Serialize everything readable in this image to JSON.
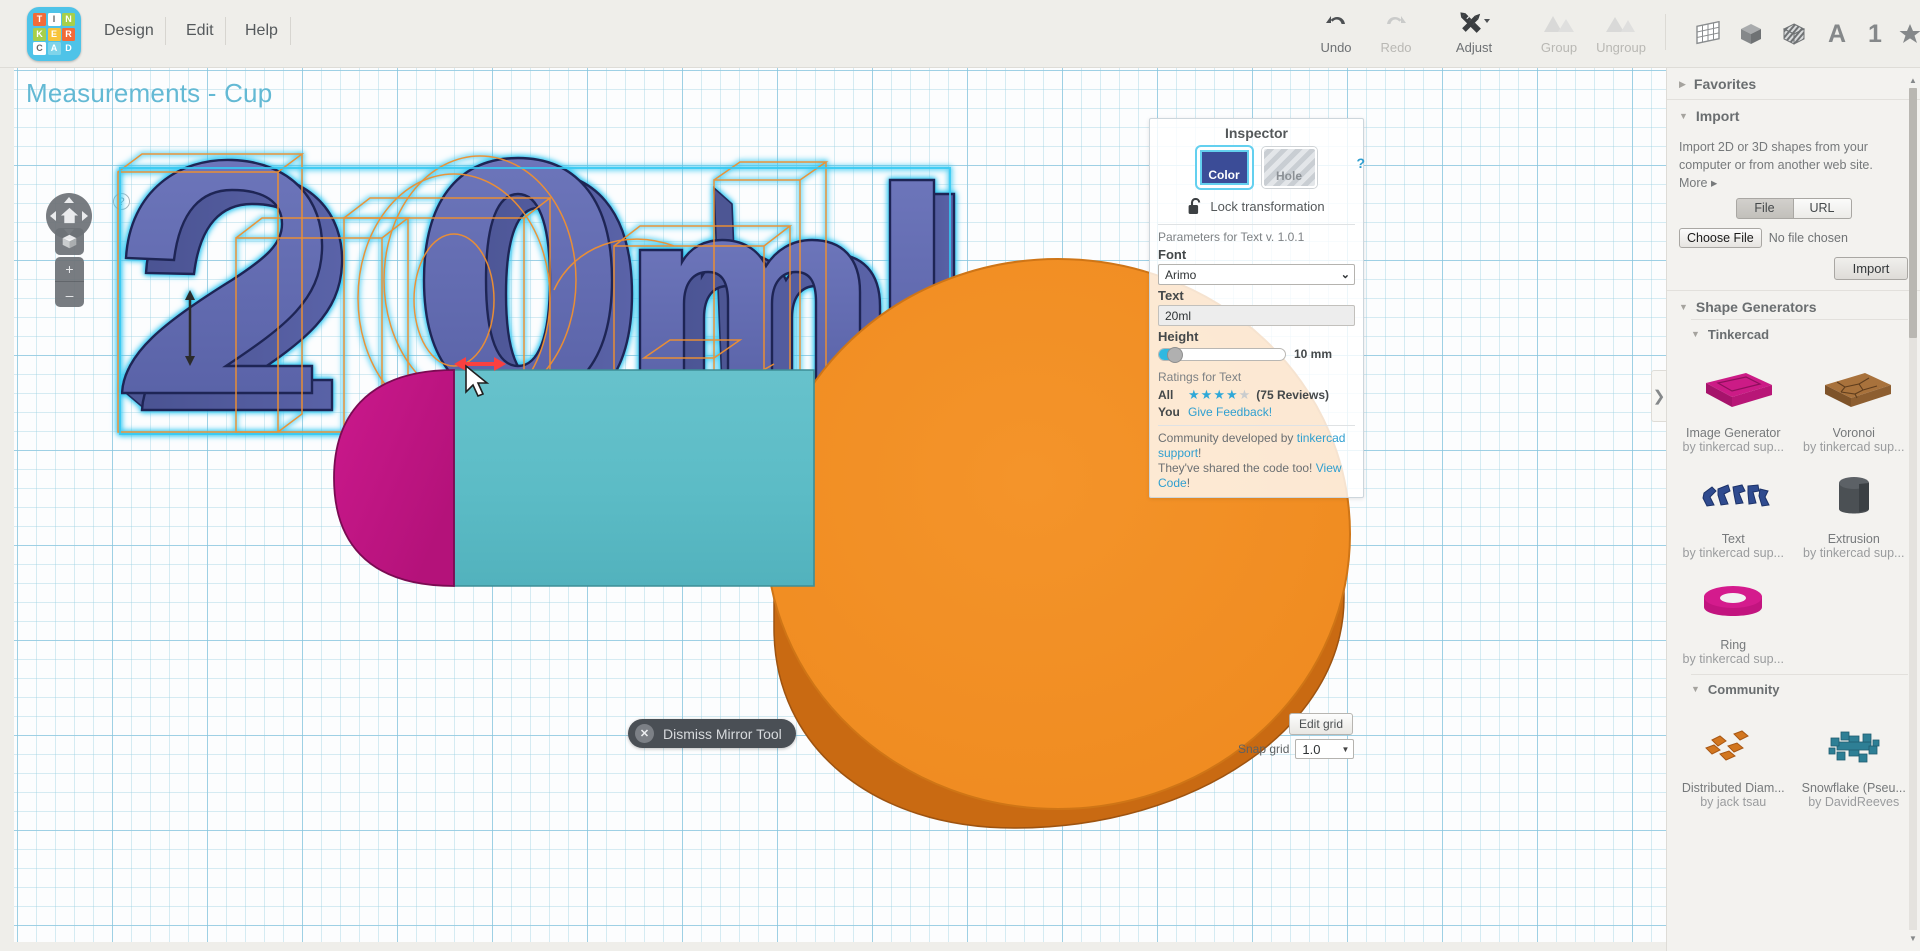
{
  "app": {
    "logo_letters": [
      "T",
      "I",
      "N",
      "K",
      "E",
      "R",
      "C",
      "A",
      "D"
    ],
    "menus": [
      "Design",
      "Edit",
      "Help"
    ]
  },
  "toolbar": {
    "buttons": [
      {
        "label": "Undo",
        "icon": "undo-icon",
        "enabled": true
      },
      {
        "label": "Redo",
        "icon": "redo-icon",
        "enabled": false
      },
      {
        "label": "Adjust",
        "icon": "adjust-icon",
        "enabled": true
      },
      {
        "label": "Group",
        "icon": "group-icon",
        "enabled": false
      },
      {
        "label": "Ungroup",
        "icon": "ungroup-icon",
        "enabled": false
      }
    ],
    "right_icons": [
      {
        "name": "workplane-grid-icon",
        "glyph": "grid"
      },
      {
        "name": "solid-cube-icon",
        "glyph": "cube"
      },
      {
        "name": "patterned-cube-icon",
        "glyph": "cube-pattern"
      },
      {
        "name": "text-letter-icon",
        "glyph": "A"
      },
      {
        "name": "number-icon",
        "glyph": "1"
      },
      {
        "name": "favorites-star-icon",
        "glyph": "star"
      }
    ]
  },
  "canvas": {
    "title": "Measurements - Cup",
    "help_glyph": "?",
    "nav": {
      "home_icon": "home-icon",
      "cube_icon": "view-cube-icon",
      "zoom_in": "+",
      "zoom_out": "–"
    },
    "dismiss_mirror": {
      "label": "Dismiss Mirror Tool",
      "close_glyph": "✕"
    },
    "edit_grid_label": "Edit grid",
    "snap_grid_label": "Snap grid",
    "snap_grid_value": "1.0",
    "caret": "▼",
    "colors": {
      "text_object": "#5a63a8",
      "text_object_dark": "#4a5392",
      "selection": "#35c9f2",
      "wireframe": "#f09030",
      "cylinder": "#5ebcc6",
      "dome": "#c2147f",
      "disc": "#f08b22",
      "disc_side": "#c96a12",
      "mirror_arrow": "#fa4040",
      "grid_minor": "#96cde1",
      "grid_major": "#5aafd2"
    },
    "scene_text": "20ml"
  },
  "inspector": {
    "title": "Inspector",
    "color_label": "Color",
    "hole_label": "Hole",
    "help_glyph": "?",
    "lock_label": "Lock transformation",
    "lock_icon": "unlocked-padlock-icon",
    "params_note": "Parameters for Text v. 1.0.1",
    "font_label": "Font",
    "font_value": "Arimo",
    "text_label": "Text",
    "text_value": "20ml",
    "height_label": "Height",
    "height_value": "10 mm",
    "ratings_title": "Ratings for Text",
    "rating_all_key": "All",
    "rating_stars_filled": 4,
    "rating_stars_total": 5,
    "rating_count": "(75 Reviews)",
    "rating_you_key": "You",
    "give_feedback": "Give Feedback!",
    "community_prefix": "Community developed by ",
    "community_author": "tinkercad support",
    "community_suffix": "!",
    "code_shared_text": "They've shared the code too! ",
    "view_code": "View Code",
    "view_code_suffix": "!",
    "color_hex": "#3b4c97",
    "accent_hex": "#2f9fd0",
    "select_caret": "⌄"
  },
  "collapse_handle": {
    "glyph": "❯"
  },
  "sidebar": {
    "favorites": {
      "title": "Favorites",
      "tri": "▶",
      "expanded": false
    },
    "import": {
      "title": "Import",
      "tri": "▼",
      "description": "Import 2D or 3D shapes from your computer or from another web site.",
      "more": "More ▸",
      "tab_file": "File",
      "tab_url": "URL",
      "choose_file": "Choose File",
      "file_status": "No file chosen",
      "import_button": "Import"
    },
    "shape_generators": {
      "title": "Shape Generators",
      "tri": "▼",
      "groups": [
        {
          "title": "Tinkercad",
          "tri": "▼",
          "shapes": [
            {
              "name": "Image Generator",
              "author": "by tinkercad sup...",
              "thumb": "plate-magenta"
            },
            {
              "name": "Voronoi",
              "author": "by tinkercad sup...",
              "thumb": "plate-voronoi"
            },
            {
              "name": "Text",
              "author": "by tinkercad sup...",
              "thumb": "text-blue"
            },
            {
              "name": "Extrusion",
              "author": "by tinkercad sup...",
              "thumb": "cylinder-dark"
            },
            {
              "name": "Ring",
              "author": "by tinkercad sup...",
              "thumb": "ring-magenta"
            }
          ]
        },
        {
          "title": "Community",
          "tri": "▼",
          "shapes": [
            {
              "name": "Distributed Diam...",
              "author": "by jack tsau",
              "thumb": "diamonds-orange"
            },
            {
              "name": "Snowflake (Pseu...",
              "author": "by DavidReeves",
              "thumb": "snowflake-teal"
            }
          ]
        }
      ]
    },
    "scrollbar": {
      "up": "▲",
      "down": "▼"
    }
  }
}
